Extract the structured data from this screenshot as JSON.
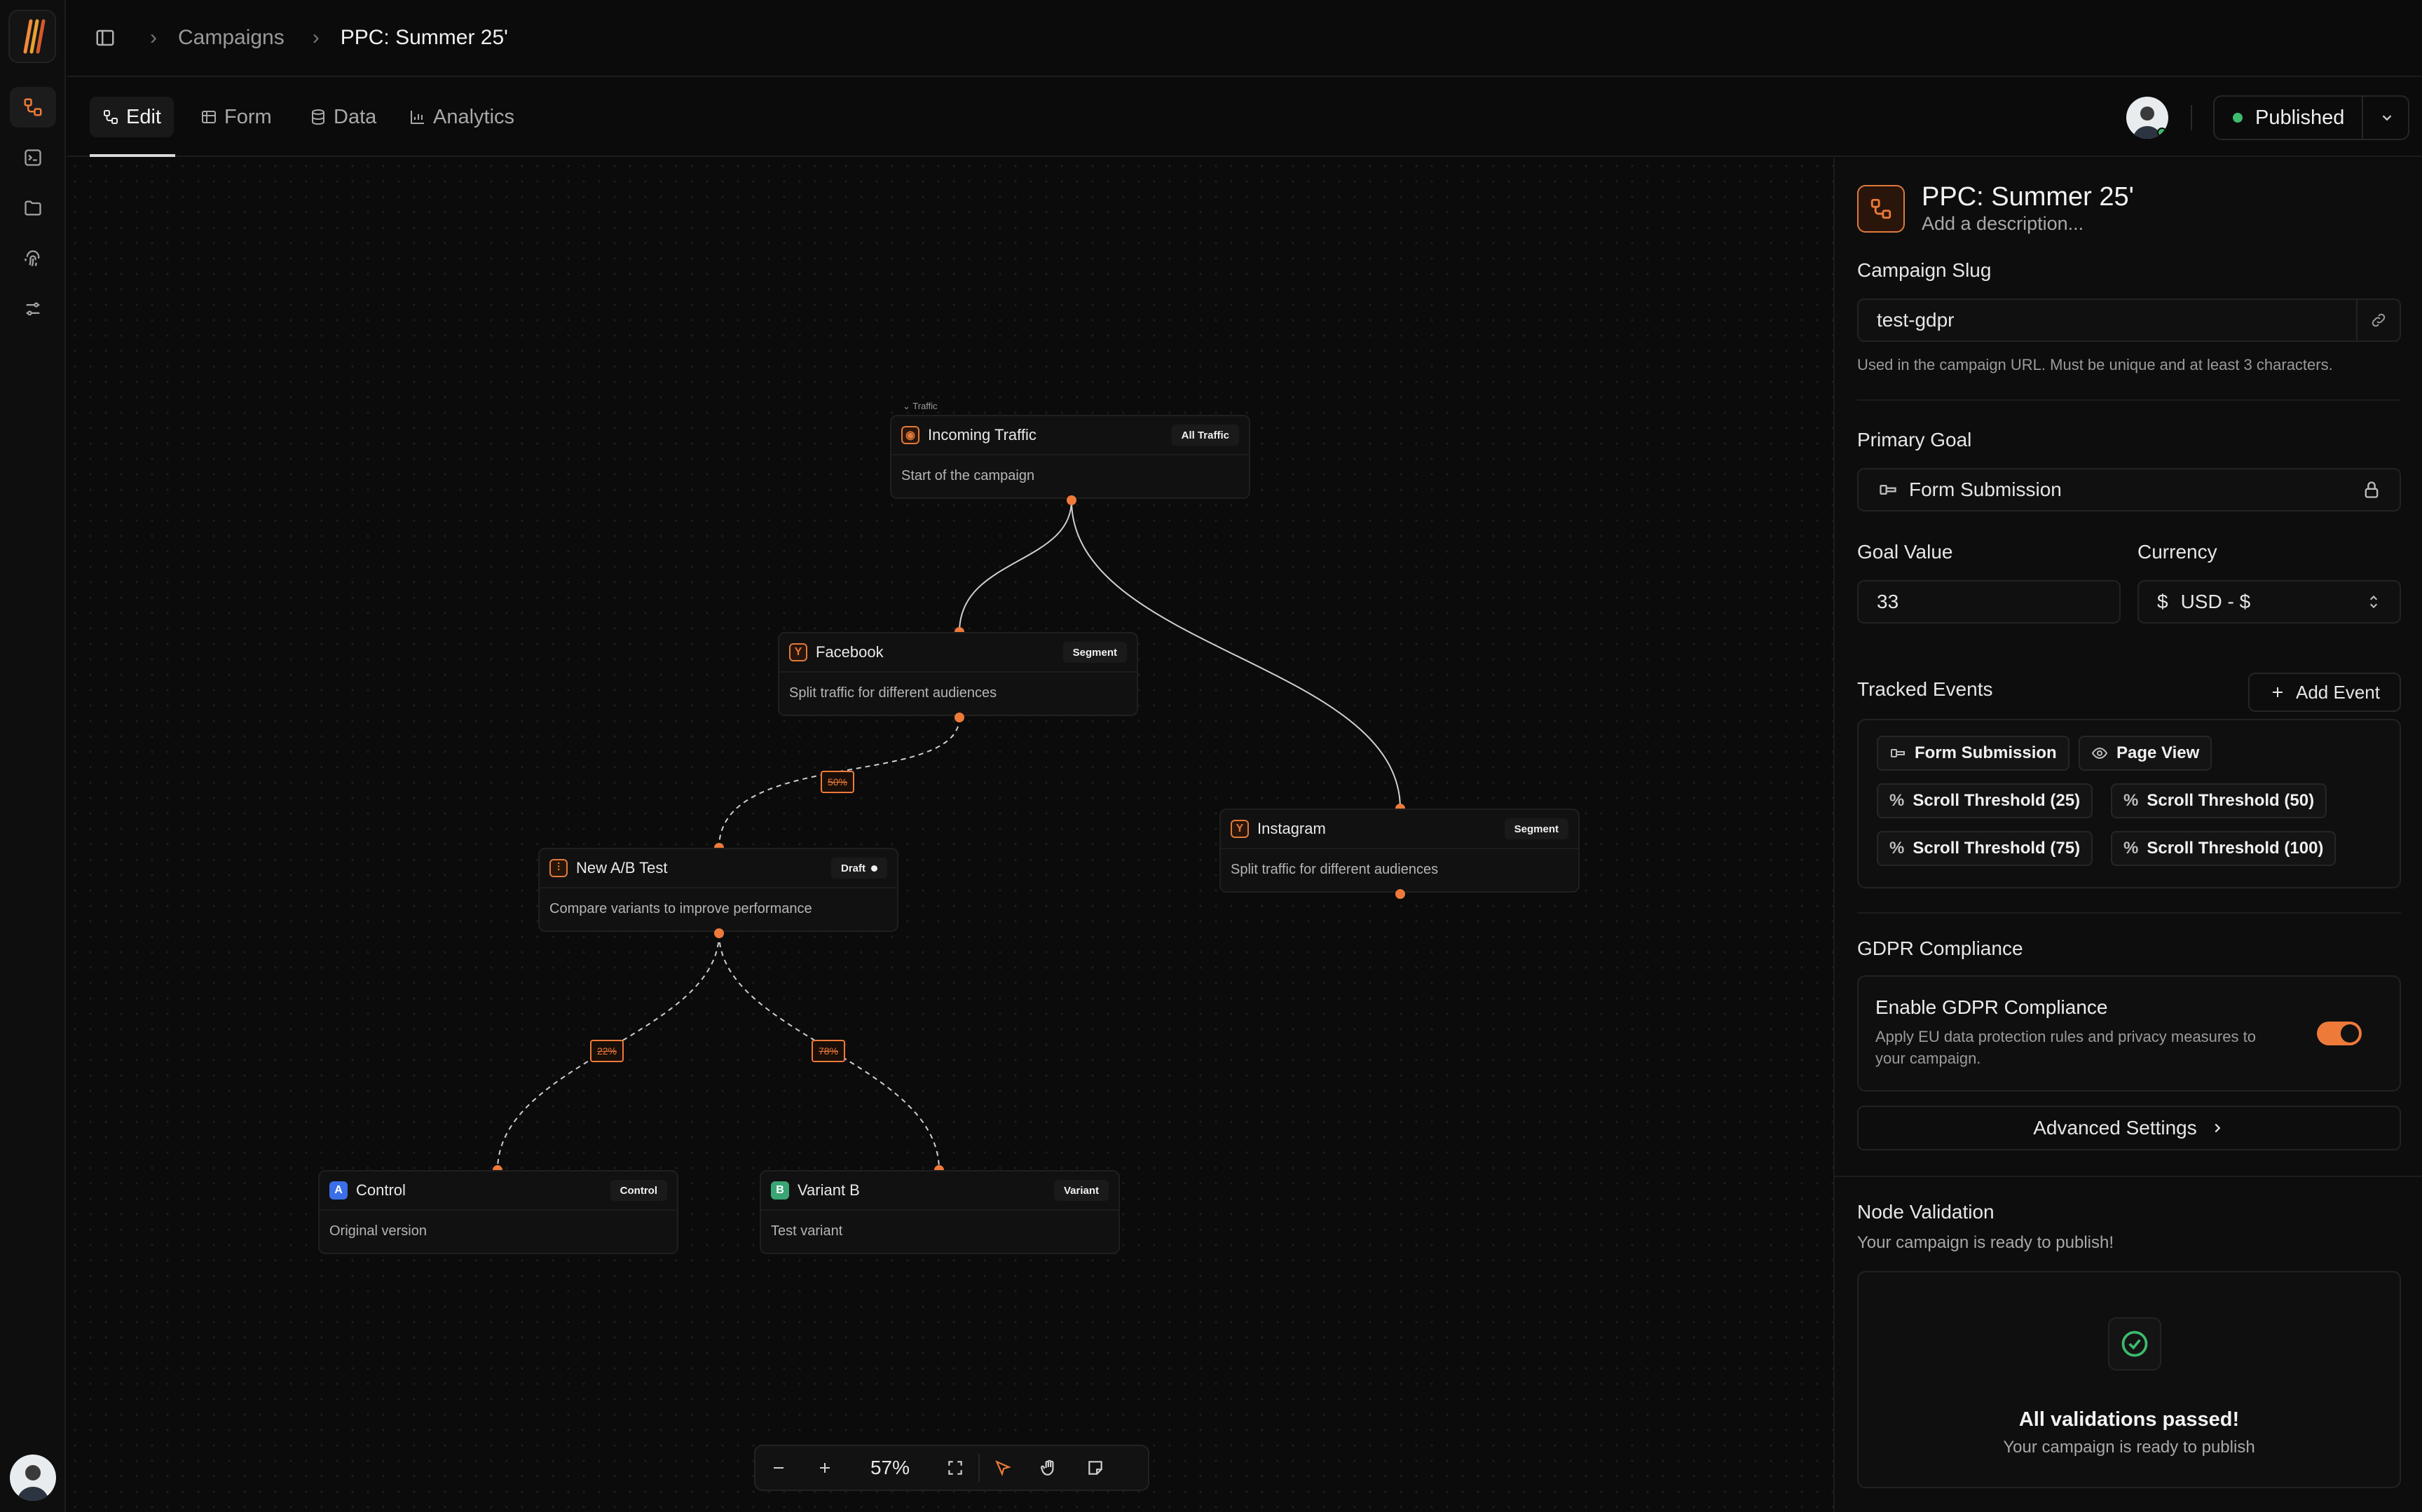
{
  "breadcrumb": {
    "items": [
      "Campaigns",
      "PPC: Summer 25'"
    ]
  },
  "tabs": [
    {
      "label": "Edit",
      "icon": "edit-flow-icon",
      "active": true
    },
    {
      "label": "Form",
      "icon": "table-icon"
    },
    {
      "label": "Data",
      "icon": "database-icon"
    },
    {
      "label": "Analytics",
      "icon": "chart-icon"
    }
  ],
  "publish": {
    "label": "Published",
    "color": "#3dbb6e"
  },
  "canvas": {
    "zoom": "57%",
    "nodes": {
      "traffic": {
        "tag": "Traffic",
        "title": "Incoming Traffic",
        "badge": "All Traffic",
        "desc": "Start of the campaign"
      },
      "facebook": {
        "title": "Facebook",
        "badge": "Segment",
        "desc": "Split traffic for different audiences"
      },
      "instagram": {
        "title": "Instagram",
        "badge": "Segment",
        "desc": "Split traffic for different audiences"
      },
      "abtest": {
        "title": "New A/B Test",
        "badge": "Draft",
        "desc": "Compare variants to improve performance"
      },
      "control": {
        "icon_letter": "A",
        "title": "Control",
        "badge": "Control",
        "desc": "Original version"
      },
      "variant": {
        "icon_letter": "B",
        "title": "Variant B",
        "badge": "Variant",
        "desc": "Test variant"
      }
    },
    "edge_labels": {
      "fb_to_ab": "50%",
      "ab_to_control": "22%",
      "ab_to_variant": "78%"
    }
  },
  "panel": {
    "title": "PPC: Summer 25'",
    "description_placeholder": "Add a description...",
    "slug": {
      "label": "Campaign Slug",
      "value": "test-gdpr",
      "hint": "Used in the campaign URL. Must be unique and at least 3 characters."
    },
    "primary_goal": {
      "label": "Primary Goal",
      "value": "Form Submission"
    },
    "goal_value": {
      "label": "Goal Value",
      "value": "33"
    },
    "currency": {
      "label": "Currency",
      "symbol": "$",
      "value": "USD - $"
    },
    "tracked_events": {
      "label": "Tracked Events",
      "add_label": "Add Event",
      "events": [
        "Form Submission",
        "Page View",
        "Scroll Threshold (25)",
        "Scroll Threshold (50)",
        "Scroll Threshold (75)",
        "Scroll Threshold (100)"
      ]
    },
    "gdpr": {
      "label": "GDPR Compliance",
      "toggle_title": "Enable GDPR Compliance",
      "toggle_desc": "Apply EU data protection rules and privacy measures to your campaign.",
      "enabled": true
    },
    "advanced_label": "Advanced Settings",
    "validation": {
      "label": "Node Validation",
      "subtitle": "Your campaign is ready to publish!",
      "result_title": "All validations passed!",
      "result_desc": "Your campaign is ready to publish"
    }
  },
  "colors": {
    "accent": "#ee7a3a",
    "success": "#3dbb6e"
  }
}
